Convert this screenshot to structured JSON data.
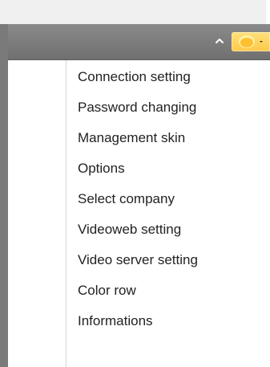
{
  "toolbar": {
    "collapse_icon": "chevron-up-icon",
    "skin_icon": "yellow-circle-dropdown-icon",
    "skin_color": "#ffc84a",
    "toolbar_color": "#7f7f7f"
  },
  "menu": {
    "items": [
      {
        "label": "Connection setting"
      },
      {
        "label": "Password changing"
      },
      {
        "label": "Management skin"
      },
      {
        "label": "Options"
      },
      {
        "label": "Select company"
      },
      {
        "label": "Videoweb setting"
      },
      {
        "label": "Video server setting"
      },
      {
        "label": "Color row"
      },
      {
        "label": "Informations"
      }
    ]
  }
}
